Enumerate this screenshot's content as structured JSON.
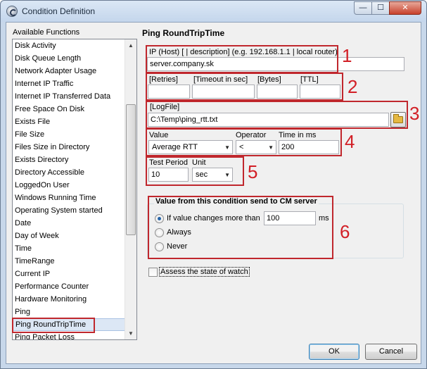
{
  "window": {
    "title": "Condition Definition",
    "controls": {
      "minimize": "—",
      "maximize": "☐",
      "close": "✕"
    }
  },
  "functions": {
    "header": "Available Functions",
    "items": [
      "Disk Activity",
      "Disk Queue Length",
      "Network Adapter Usage",
      "Internet IP Traffic",
      "Internet IP Transferred Data",
      "Free Space On Disk",
      "Exists File",
      "File Size",
      "Files Size in Directory",
      "Exists Directory",
      "Directory Accessible",
      "LoggedOn User",
      "Windows Running Time",
      "Operating System started",
      "Date",
      "Day of Week",
      "Time",
      "TimeRange",
      "Current IP",
      "Performance Counter",
      "Hardware Monitoring",
      "Ping",
      "Ping RoundTripTime",
      "Ping Packet Loss"
    ],
    "selected_index": 22
  },
  "panel": {
    "title": "Ping RoundTripTime",
    "ip": {
      "label": "IP (Host) [ | description]   (e.g. 192.168.1.1 | local router)",
      "value": "server.company.sk"
    },
    "params": {
      "retries_label": "[Retries]",
      "timeout_label": "[Timeout in sec]",
      "bytes_label": "[Bytes]",
      "ttl_label": "[TTL]",
      "retries_value": "",
      "timeout_value": "",
      "bytes_value": "",
      "ttl_value": ""
    },
    "logfile": {
      "label": "[LogFile]",
      "value": "C:\\Temp\\ping_rtt.txt"
    },
    "value_row": {
      "value_label": "Value",
      "value_selected": "Average RTT",
      "operator_label": "Operator",
      "operator_selected": "<",
      "time_label": "Time in ms",
      "time_value": "200"
    },
    "test_period": {
      "period_label": "Test Period",
      "period_value": "10",
      "unit_label": "Unit",
      "unit_selected": "sec"
    },
    "send_group": {
      "title": "Value from this condition send to CM server",
      "option_changes": "If value changes more than",
      "changes_value": "100",
      "changes_unit": "ms",
      "option_always": "Always",
      "option_never": "Never",
      "selected": "changes"
    },
    "assess_label": "Assess the state of watch"
  },
  "callouts": [
    "1",
    "2",
    "3",
    "4",
    "5",
    "6"
  ],
  "buttons": {
    "ok": "OK",
    "cancel": "Cancel"
  },
  "colors": {
    "highlight": "#c0272d",
    "callout": "#d21f26",
    "selection": "#dce7f5"
  }
}
